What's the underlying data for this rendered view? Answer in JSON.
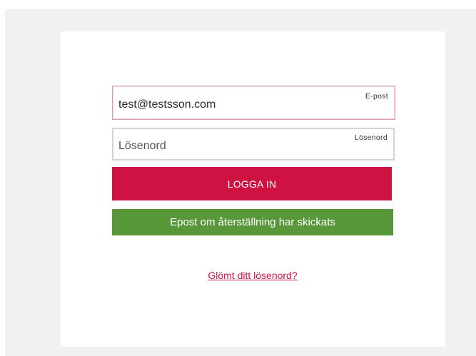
{
  "login_form": {
    "email": {
      "value": "test@testsson.com",
      "label": "E-post"
    },
    "password": {
      "value": "",
      "placeholder": "Lösenord",
      "label": "Lösenord"
    },
    "login_button_label": "LOGGA IN",
    "status_message": "Epost om återställning har skickats",
    "forgot_password_link": "Glömt ditt lösenord?"
  },
  "colors": {
    "background": "#f1f1f1",
    "card": "#ffffff",
    "primary": "#d01243",
    "success": "#58973a",
    "link": "#c8174a"
  }
}
